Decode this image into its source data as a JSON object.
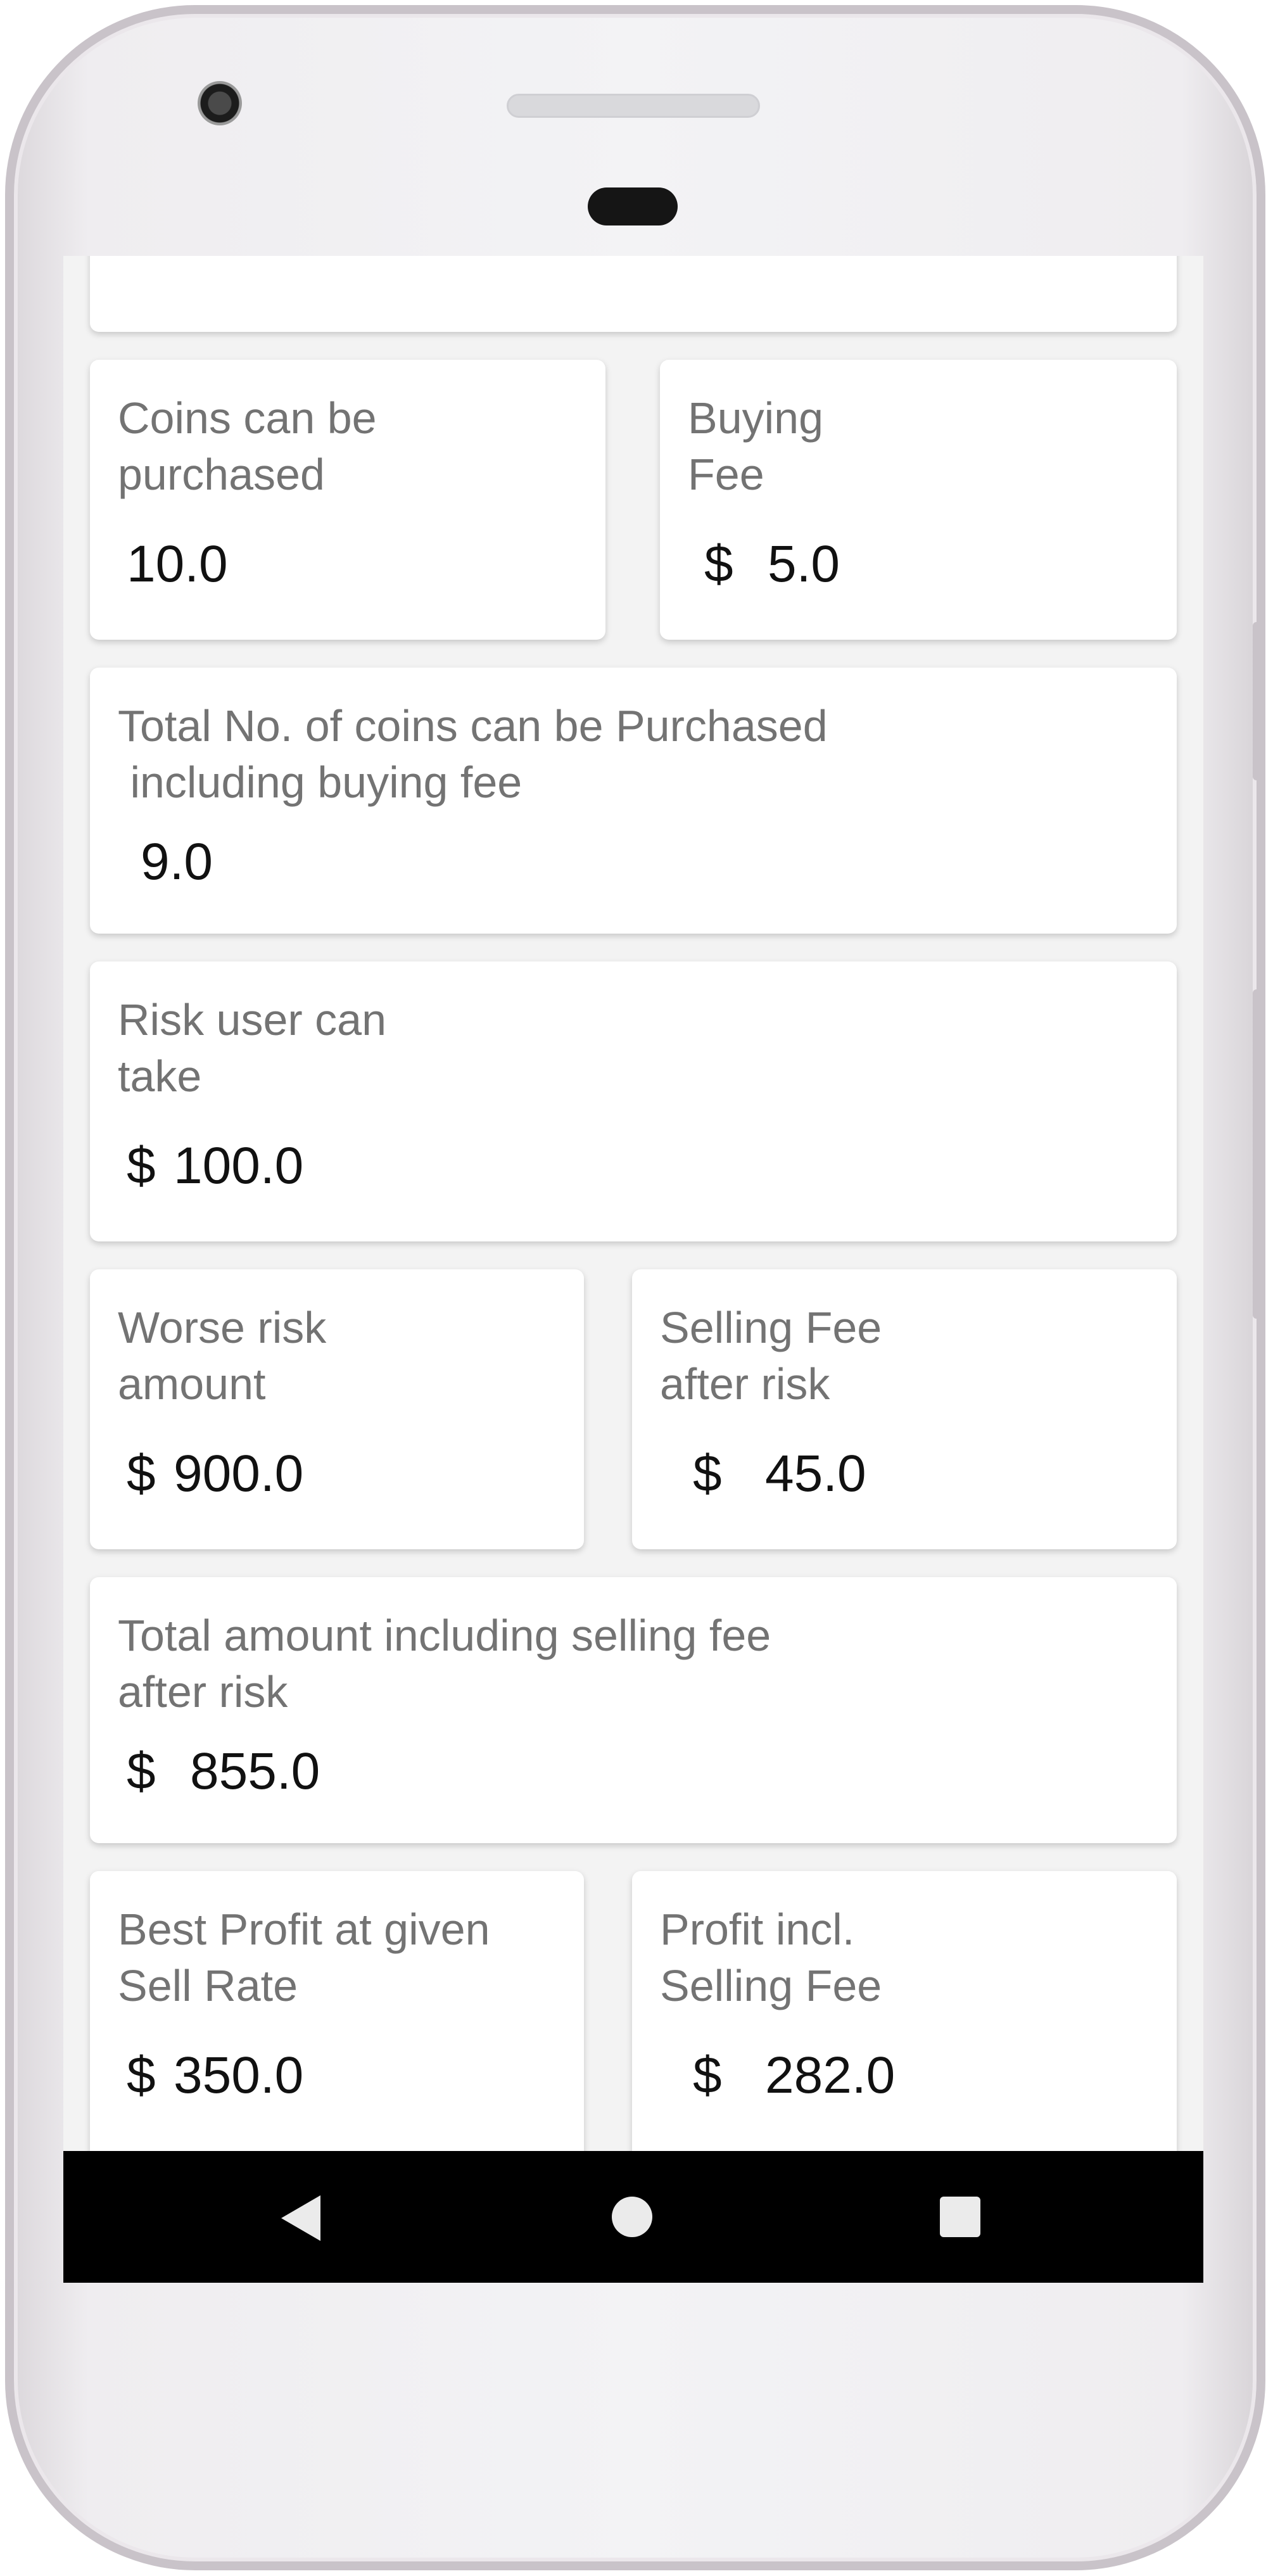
{
  "cards": {
    "coins_purchased": {
      "label": "Coins can be\npurchased",
      "value": "10.0"
    },
    "buying_fee": {
      "label": "Buying\nFee",
      "currency": "$",
      "value": "5.0"
    },
    "total_coins": {
      "label": "Total No. of coins can be Purchased\n including buying fee",
      "value": "9.0"
    },
    "risk": {
      "label": "Risk user can\ntake",
      "currency": "$",
      "value": "100.0"
    },
    "worse_risk": {
      "label": "Worse risk\namount",
      "currency": "$",
      "value": "900.0"
    },
    "selling_fee": {
      "label": "Selling Fee\nafter risk",
      "currency": "$",
      "value": "45.0"
    },
    "total_selling": {
      "label": "Total amount including selling fee\nafter risk",
      "currency": "$",
      "value": "855.0"
    },
    "best_profit": {
      "label": "Best Profit at given\nSell Rate",
      "currency": "$",
      "value": "350.0"
    },
    "profit_fee": {
      "label": "Profit incl.\nSelling Fee",
      "currency": "$",
      "value": "282.0"
    }
  },
  "navbar": {
    "back_icon": "back-triangle-icon",
    "home_icon": "home-circle-icon",
    "recents_icon": "recents-square-icon"
  },
  "colors": {
    "screen_bg": "#f3f3f3",
    "card_bg": "#ffffff",
    "label": "#737373",
    "value": "#111111",
    "navbar": "#000000"
  }
}
